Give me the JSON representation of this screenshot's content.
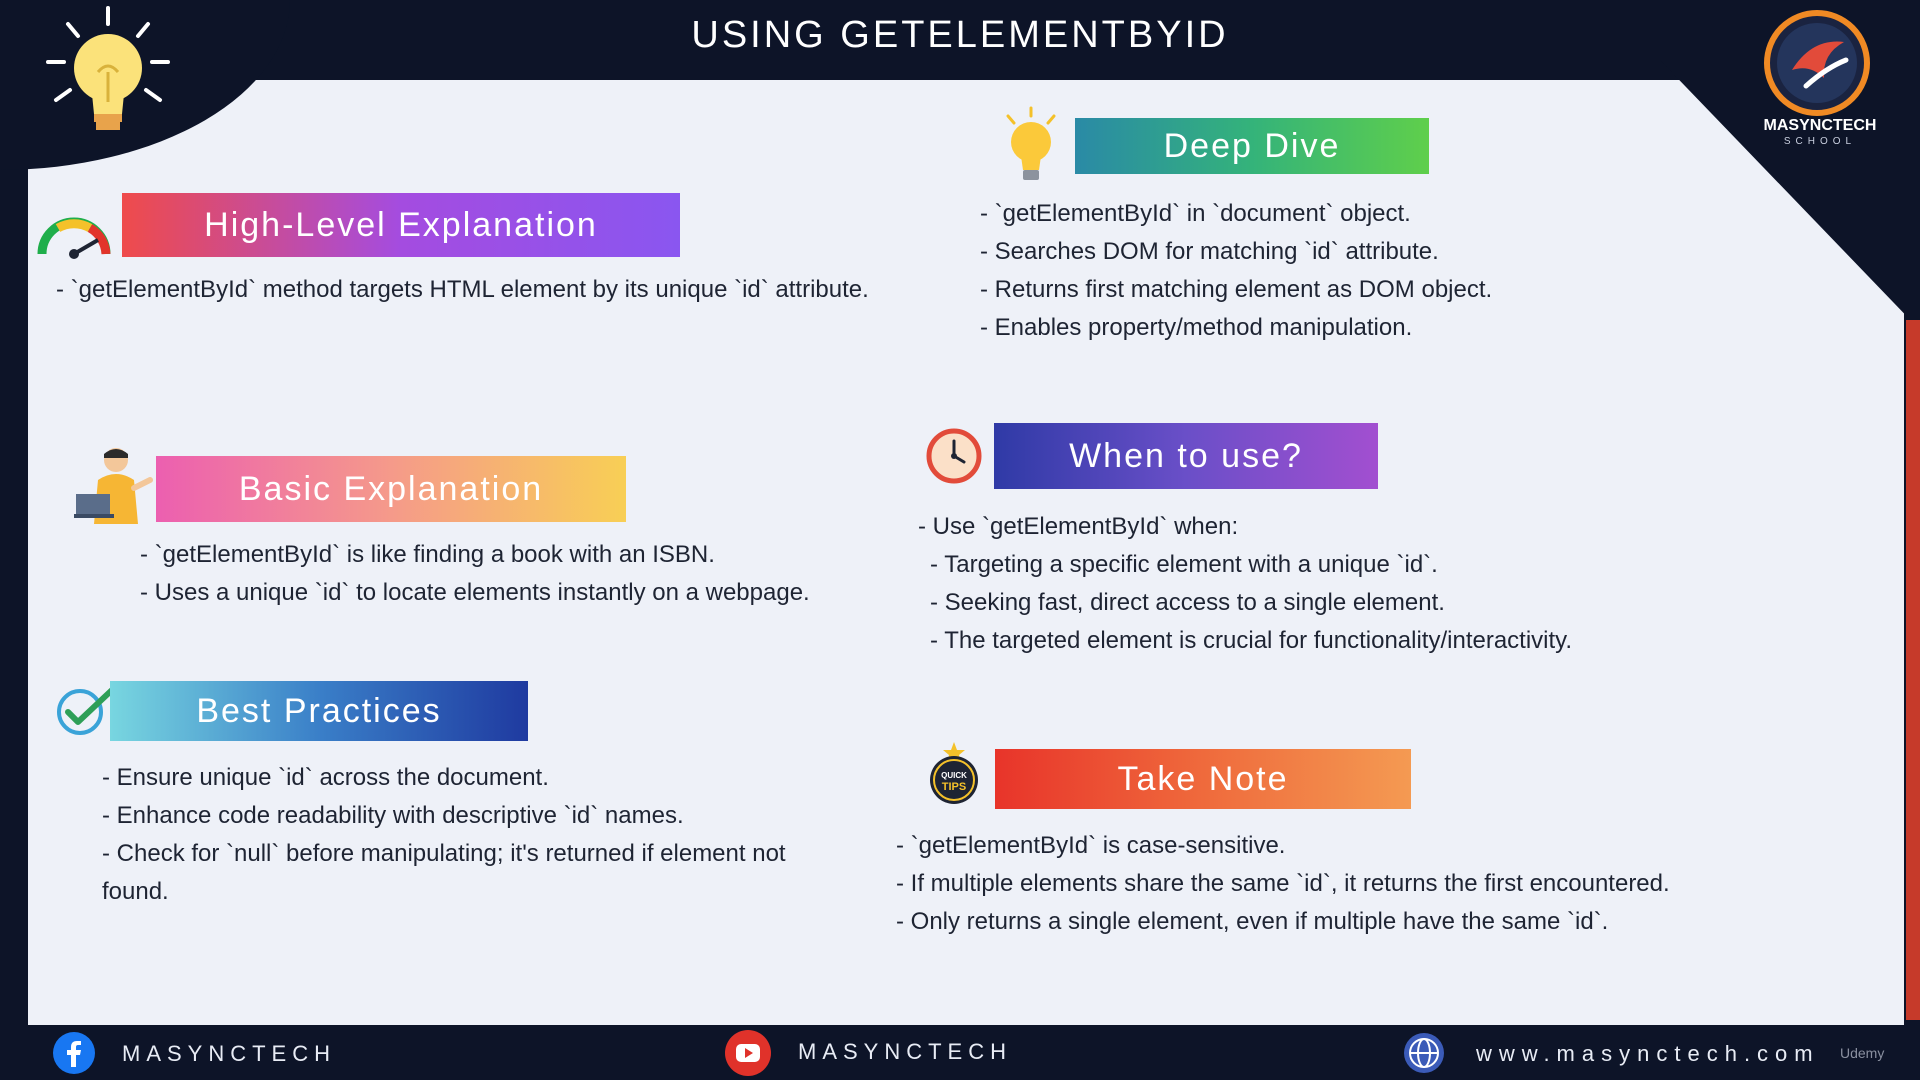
{
  "title": "USING GETELEMENTBYID",
  "logo": {
    "brand": "MASYNCTECH",
    "sub": "SCHOOL"
  },
  "sections": {
    "high_level": {
      "label": "High-Level Explanation",
      "lines": [
        "- `getElementById` method targets HTML element by its unique `id` attribute."
      ]
    },
    "deep_dive": {
      "label": "Deep Dive",
      "lines": [
        "- `getElementById` in `document` object.",
        "- Searches DOM for matching `id` attribute.",
        "- Returns first matching element as DOM object.",
        "- Enables property/method manipulation."
      ]
    },
    "basic": {
      "label": "Basic Explanation",
      "lines": [
        "- `getElementById` is like finding a book with an ISBN.",
        "- Uses a unique `id` to locate elements instantly on a webpage."
      ]
    },
    "when": {
      "label": "When to use?",
      "lines": [
        "- Use `getElementById` when:",
        "- Targeting a specific element with a unique `id`.",
        "- Seeking fast, direct access to a single element.",
        "- The targeted element is crucial for functionality/interactivity."
      ]
    },
    "best": {
      "label": "Best Practices",
      "lines": [
        "- Ensure unique `id` across the document.",
        "- Enhance code readability with descriptive `id` names.",
        "- Check for `null` before manipulating; it's returned if element not",
        "found."
      ]
    },
    "note": {
      "label": "Take Note",
      "lines": [
        "- `getElementById` is case-sensitive.",
        "- If multiple elements share the same `id`, it returns the first encountered.",
        "- Only returns a single element, even if multiple have the same `id`."
      ]
    }
  },
  "quick_tips": {
    "line1": "QUICK",
    "line2": "TIPS"
  },
  "footer": {
    "facebook": "MASYNCTECH",
    "youtube": "MASYNCTECH",
    "website": "www.masynctech.com",
    "watermark": "Udemy"
  }
}
